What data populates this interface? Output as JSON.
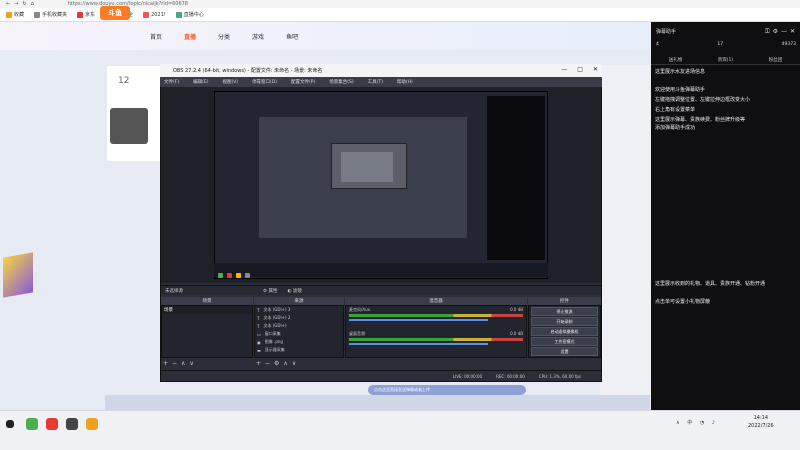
{
  "browser": {
    "address": "https://www.douyu.com/topic/nicaijk?rid=60678",
    "bookmarks": [
      "收藏",
      "手机收藏夹",
      "京东",
      "游戏大全",
      "2021!",
      "直播中心"
    ]
  },
  "site": {
    "nav": [
      "首页",
      "直播",
      "分类",
      "游戏",
      "鱼吧"
    ],
    "room_count": "12",
    "chat_placeholder": "点击这里直接发送弹幕或者上传"
  },
  "obs": {
    "title": "OBS 27.2.4 (64-bit, windows) - 配置文件: 未命名 - 场景: 未命名",
    "menu": [
      "文件(F)",
      "编辑(E)",
      "视图(V)",
      "停靠窗口(D)",
      "配置文件(P)",
      "场景集合(S)",
      "工具(T)",
      "帮助(H)"
    ],
    "toolbar": {
      "no_source": "未选择源",
      "props": "属性",
      "filters": "滤镜"
    },
    "docks": {
      "scenes": {
        "title": "场景",
        "items": [
          "场景"
        ]
      },
      "sources": {
        "title": "来源",
        "items": [
          "文本 (GDI+) 3",
          "文本 (GDI+) 2",
          "文本 (GDI+)",
          "窗口采集",
          "图像 .png",
          "显示器采集"
        ]
      },
      "mixer": {
        "title": "混音器",
        "rows": [
          {
            "name": "麦克风/Aux",
            "db": "0.0 dB"
          },
          {
            "name": "桌面音频",
            "db": "0.0 dB"
          }
        ]
      },
      "controls": {
        "title": "控件",
        "buttons": [
          "停止推流",
          "开始录制",
          "启动虚拟摄像机",
          "工作室模式",
          "设置",
          "退出"
        ]
      }
    },
    "status": {
      "live": "LIVE: 00:00:00",
      "rec": "REC: 00:00:00",
      "cpu": "CPU: 1.3%, 60.00 fps"
    }
  },
  "panel": {
    "title": "弹幕助手",
    "stats": [
      "4",
      "17",
      "49373"
    ],
    "tabs": [
      "送礼物",
      "贵宾(1)",
      "粉丝团"
    ],
    "intro": "这里展示水友进场信息",
    "messages": [
      "欢迎使用斗鱼弹幕助手",
      "左键拖拽调整位置、左键拉伸边框改变大小",
      "右上角有设置菜单",
      "这里展示弹幕、贵族续费、粉丝牌升级等",
      "添加弹幕助手成功"
    ],
    "footer": [
      "这里展示收到的礼物、道具、贵族开通、钻粉开通",
      "点击单可设置小礼物屏蔽"
    ]
  },
  "taskbar": {
    "time": "14:14",
    "date": "2022/7/26",
    "tray": "∧ 中 ◔ ♪"
  }
}
